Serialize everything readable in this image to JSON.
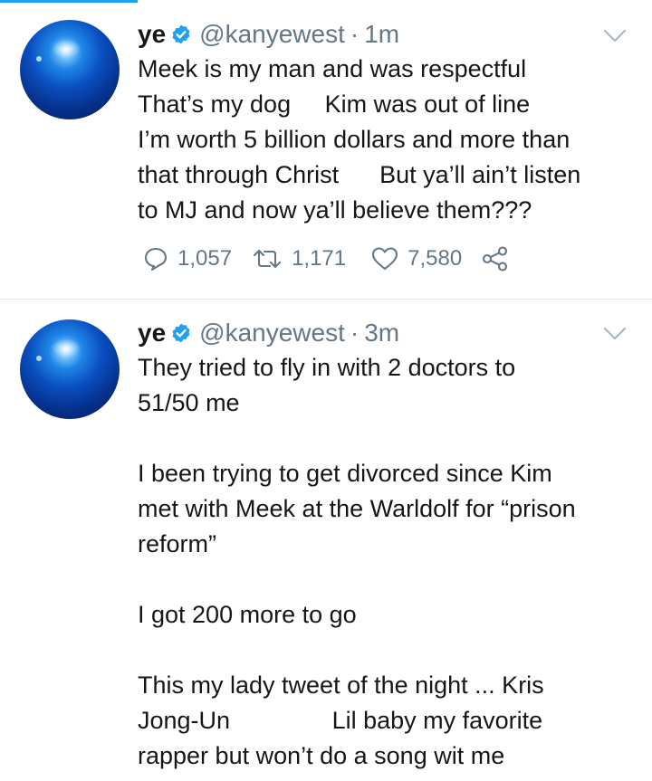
{
  "colors": {
    "accent": "#1da1f2",
    "text": "#14171a",
    "secondary": "#657786",
    "divider": "#e1e8ed"
  },
  "tweets": [
    {
      "name": "ye",
      "verified_icon": "verified-badge-icon",
      "handle": "@kanyewest",
      "separator": "·",
      "time": "1m",
      "text": "Meek is my man and was respectful\nThat’s my dog     Kim was out of line\nI’m worth 5 billion dollars and more than\nthat through Christ      But ya’ll ain’t listen\nto MJ and now ya’ll believe them???",
      "replies": "1,057",
      "retweets": "1,171",
      "likes": "7,580"
    },
    {
      "name": "ye",
      "verified_icon": "verified-badge-icon",
      "handle": "@kanyewest",
      "separator": "·",
      "time": "3m",
      "text": "They tried to fly in with 2 doctors to\n51/50 me\n\nI been trying to get divorced since Kim\nmet with Meek at the Warldolf for “prison\nreform”\n\nI got 200 more to go\n\nThis my lady tweet of the night ... Kris\nJong-Un               Lil baby my favorite\nrapper but won’t do a song wit me"
    }
  ]
}
